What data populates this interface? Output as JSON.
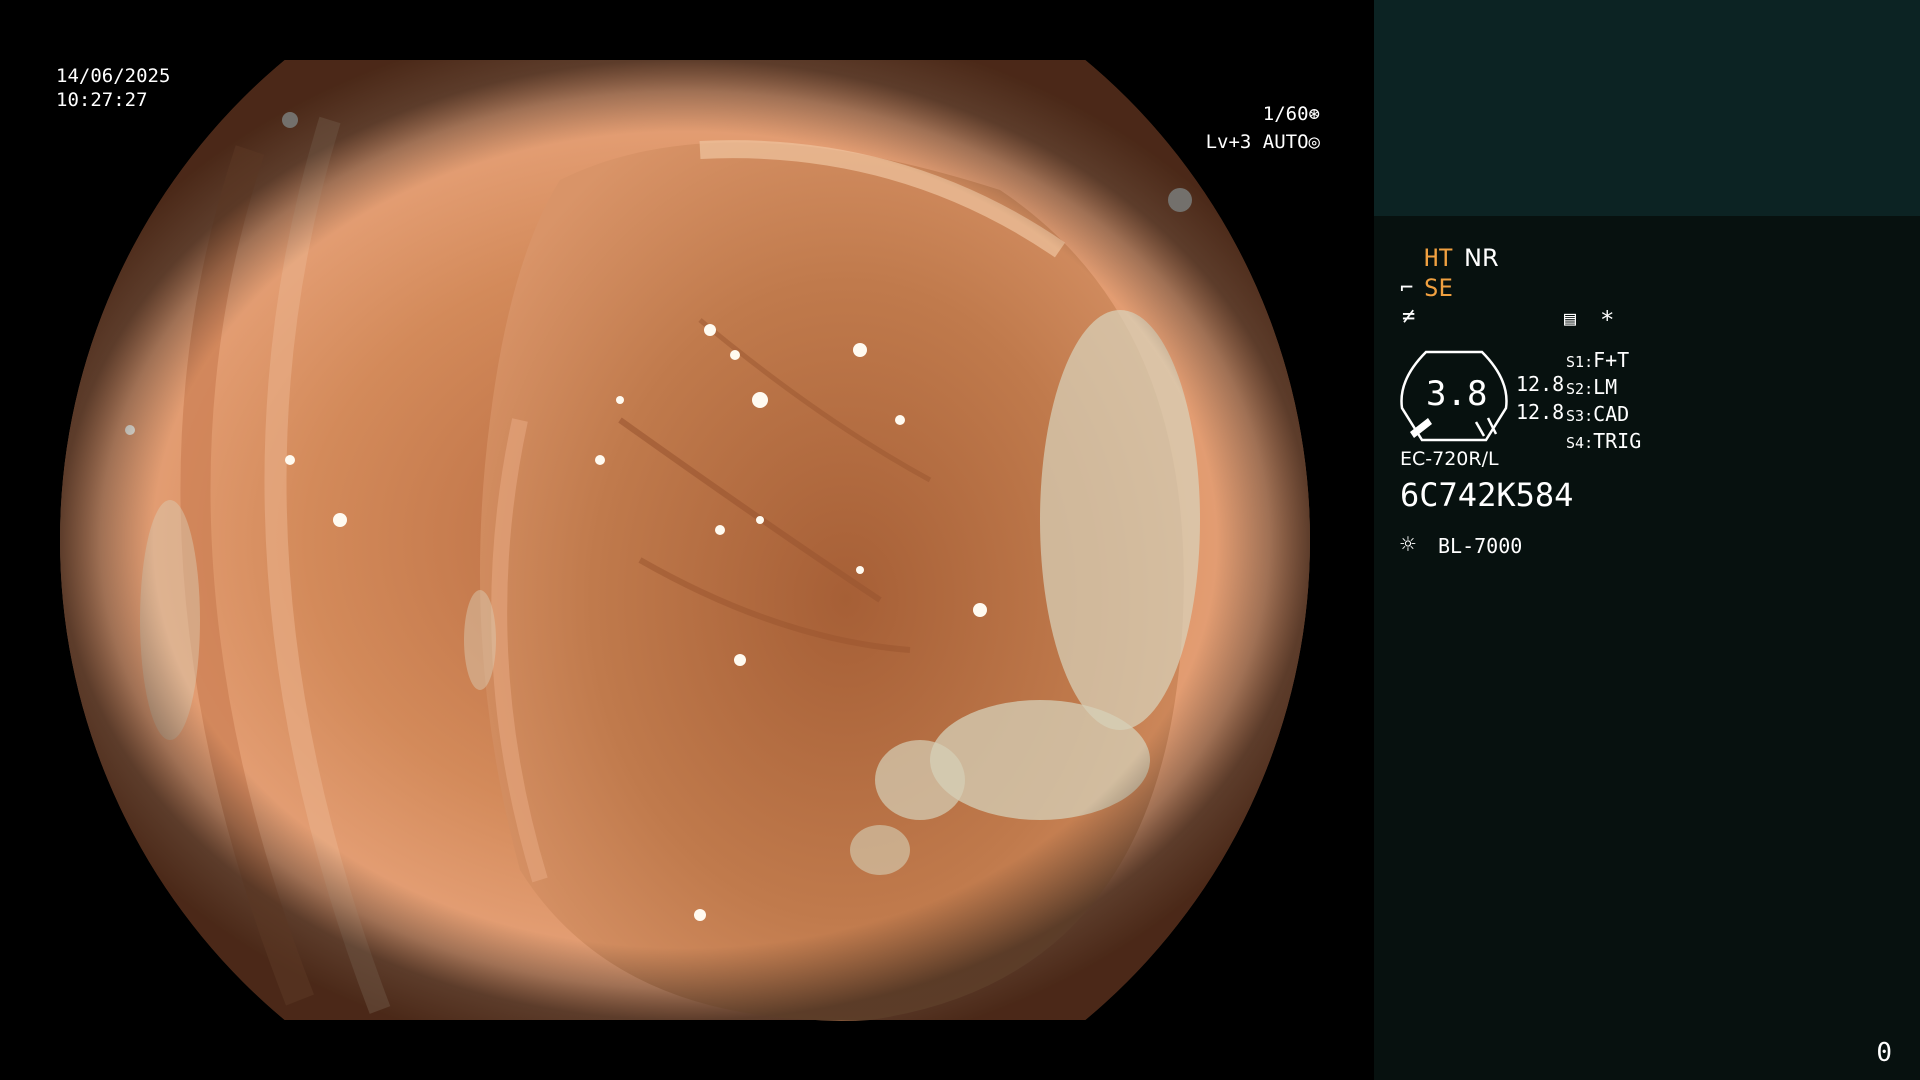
{
  "overlay": {
    "date": "14/06/2025",
    "time": "10:27:27",
    "shutter": "1/60",
    "level": "Lv+3",
    "iris": "AUTO"
  },
  "panel": {
    "ht": "HT",
    "nr": "NR",
    "se": "SE",
    "gauge_value": "3.8",
    "value_a": "12.8",
    "value_b": "12.8",
    "switches": [
      {
        "key": "S1",
        "value": "F+T"
      },
      {
        "key": "S2",
        "value": "LM"
      },
      {
        "key": "S3",
        "value": "CAD"
      },
      {
        "key": "S4",
        "value": "TRIG"
      }
    ],
    "scope_model": "EC-720R/L",
    "serial": "6C742K584",
    "light_source": "BL-7000",
    "asterisk": "*"
  },
  "counter": "0",
  "colors": {
    "panel_bg": "#07110f",
    "panel_top_bg": "#0c2323",
    "accent_orange": "#f0a040",
    "text": "#ffffff"
  }
}
